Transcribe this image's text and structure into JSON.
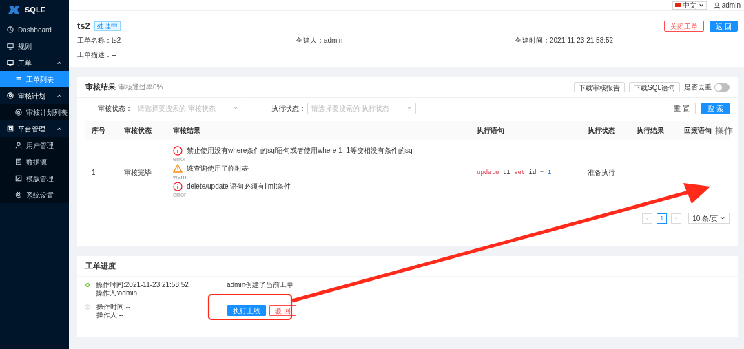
{
  "sidebar": {
    "logo": "SQLE",
    "items": [
      {
        "kind": "item",
        "label": "Dashboard",
        "selected": false
      },
      {
        "kind": "item",
        "label": "规则",
        "selected": false
      },
      {
        "kind": "group",
        "label": "工单",
        "expanded": true,
        "children": [
          {
            "label": "工单列表",
            "selected": true
          }
        ]
      },
      {
        "kind": "group",
        "label": "审核计划",
        "expanded": true,
        "children": [
          {
            "label": "审核计划列表",
            "selected": false
          }
        ]
      },
      {
        "kind": "group",
        "label": "平台管理",
        "expanded": true,
        "children": [
          {
            "label": "用户管理",
            "selected": false
          },
          {
            "label": "数据源",
            "selected": false
          },
          {
            "label": "模版管理",
            "selected": false
          },
          {
            "label": "系统设置",
            "selected": false
          }
        ]
      }
    ]
  },
  "topbar": {
    "language": "中文",
    "user": "admin"
  },
  "order": {
    "title": "ts2",
    "status": "处理中",
    "buttons": [
      {
        "label": "关闭工单",
        "kind": "danger"
      },
      {
        "label": "返 回",
        "kind": "primary"
      }
    ],
    "fields": [
      {
        "label": "工单名称：",
        "value": "ts2"
      },
      {
        "label": "创建人：",
        "value": "admin"
      },
      {
        "label": "创建时间：",
        "value": "2021-11-23 21:58:52"
      },
      {
        "label": "工单描述：",
        "value": "--"
      }
    ]
  },
  "audit": {
    "title": "审核结果",
    "pass_rate": "审核通过率0%",
    "actions": [
      "下载审核报告",
      "下载SQL语句"
    ],
    "dedupe": {
      "label": "是否去重",
      "on": false
    },
    "filters": [
      {
        "label": "审核状态：",
        "placeholder": "请选择要搜索的 审核状态"
      },
      {
        "label": "执行状态：",
        "placeholder": "请选择要搜索的 执行状态"
      }
    ],
    "filter_buttons": [
      {
        "label": "重 置",
        "kind": "default"
      },
      {
        "label": "搜 索",
        "kind": "primary"
      }
    ],
    "table": {
      "columns": [
        "序号",
        "审核状态",
        "审核结果",
        "执行语句",
        "执行状态",
        "执行结果",
        "回滚语句",
        "操作"
      ],
      "rows": [
        {
          "index": "1",
          "audit_status": "审核完毕",
          "results": [
            {
              "kind": "error",
              "label": "error",
              "message": "禁止使用没有where条件的sql语句或者使用where 1=1等变相没有条件的sql"
            },
            {
              "kind": "warn",
              "label": "warn",
              "message": "该查询使用了临时表"
            },
            {
              "kind": "error",
              "label": "error",
              "message": "delete/update 语句必须有limit条件"
            }
          ],
          "sql": [
            {
              "text": "update",
              "kind": "keyword"
            },
            {
              "text": "t1",
              "kind": "plain"
            },
            {
              "text": "set",
              "kind": "keyword"
            },
            {
              "text": "id",
              "kind": "plain"
            },
            {
              "text": "=",
              "kind": "plain"
            },
            {
              "text": "1",
              "kind": "number"
            }
          ],
          "exec_status": "准备执行"
        }
      ]
    },
    "pagination": {
      "pages": [
        {
          "label": "1",
          "selected": true
        }
      ],
      "page_size": "10 条/页"
    }
  },
  "progress": {
    "title": "工单进度",
    "steps": [
      {
        "done": true,
        "time": "操作时间:2021-11-23 21:58:52",
        "operator": "操作人:admin",
        "description": "admin创建了当前工单"
      },
      {
        "done": false,
        "time": "操作时间:--",
        "operator": "操作人:--",
        "buttons": [
          {
            "label": "执行上线",
            "kind": "primary"
          },
          {
            "label": "驳 回",
            "kind": "danger"
          }
        ]
      }
    ]
  }
}
